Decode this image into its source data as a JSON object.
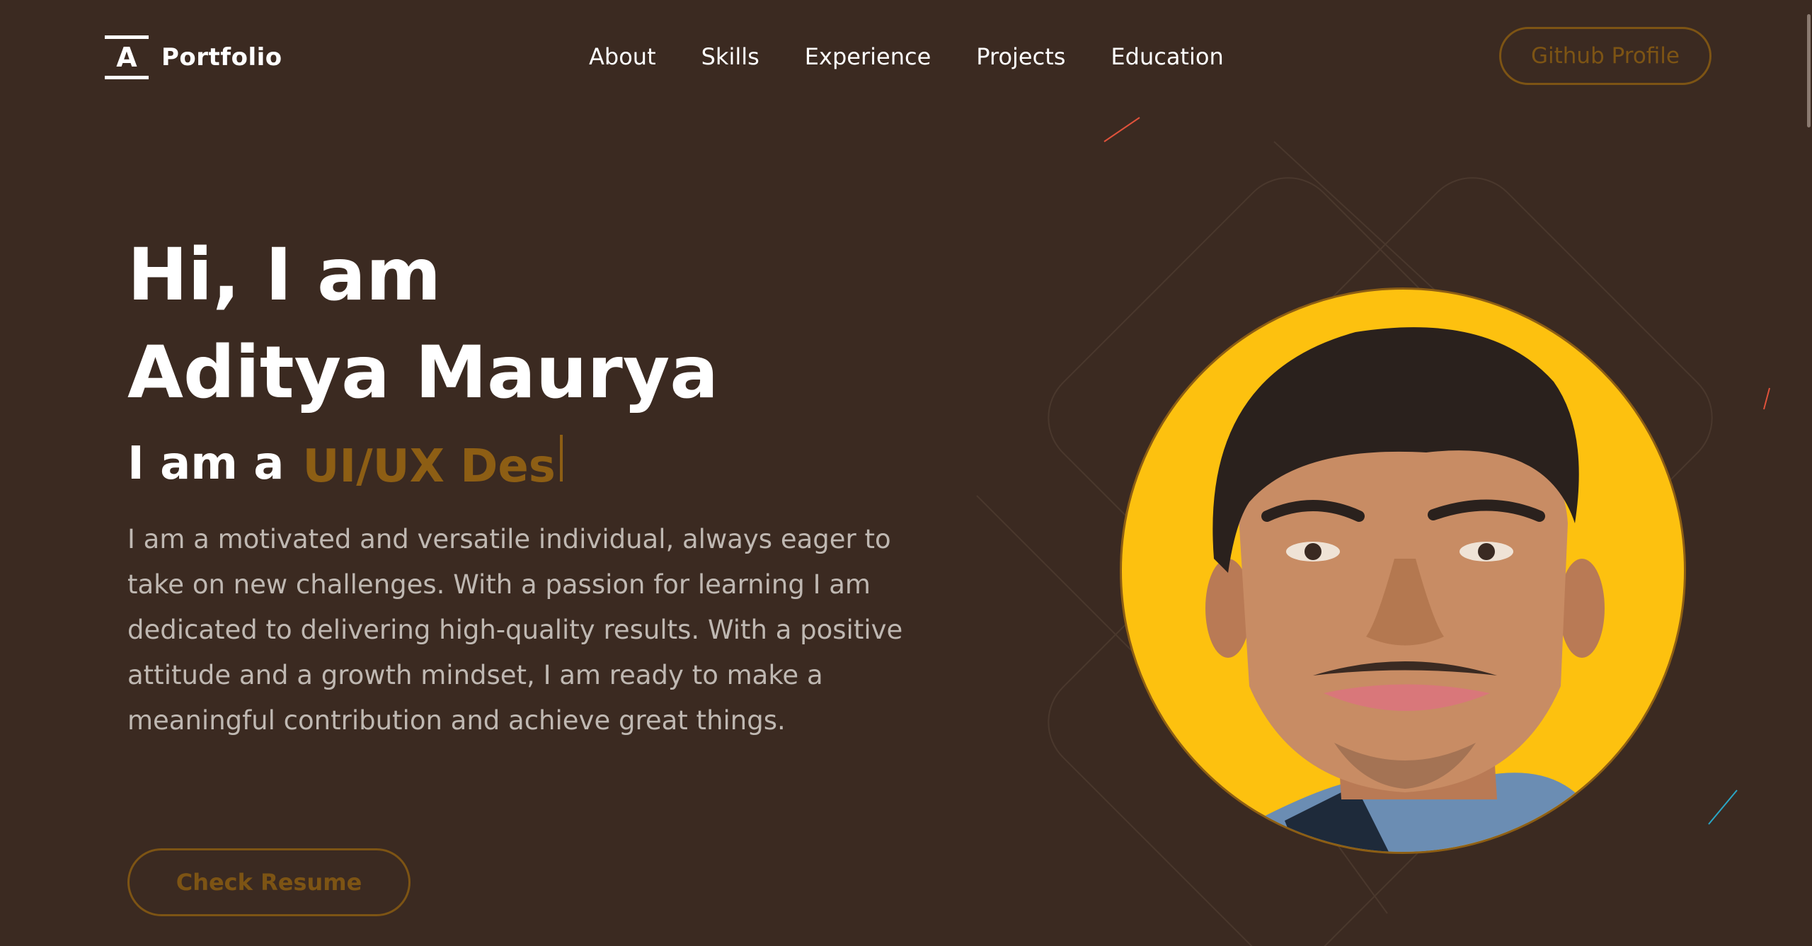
{
  "nav": {
    "logo_letter": "A",
    "logo_text": "Portfolio",
    "links": [
      "About",
      "Skills",
      "Experience",
      "Projects",
      "Education"
    ],
    "github_button": "Github Profile"
  },
  "hero": {
    "greeting": "Hi, I am",
    "name": "Aditya Maurya",
    "role_prefix": "I am a",
    "role_typed": "UI/UX Des",
    "bio": "I am a motivated and versatile individual, always eager to take on new challenges. With a passion for learning I am dedicated to delivering high-quality results. With a positive attitude and a growth mindset, I am ready to make a meaningful contribution and achieve great things.",
    "resume_button": "Check Resume"
  },
  "colors": {
    "background": "#3b2a21",
    "accent": "#8d5e14",
    "avatar_bg": "#fdc10f"
  },
  "icons": {
    "logo": "logo-icon",
    "profile_photo": "avatar"
  }
}
